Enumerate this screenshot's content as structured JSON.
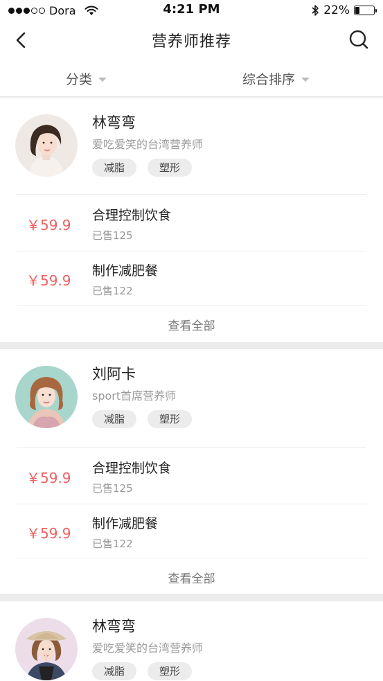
{
  "status_bar": {
    "carrier": "Dora",
    "time": "4:21 PM",
    "battery": "22%",
    "battery_level": 0.22
  },
  "nav": {
    "title": "营养师推荐"
  },
  "filters": {
    "category": "分类",
    "sort": "综合排序"
  },
  "nutritionists": [
    {
      "name": "林弯弯",
      "desc": "爱吃爱笑的台湾营养师",
      "tags": [
        "减脂",
        "塑形"
      ],
      "products": [
        {
          "price": "￥59.9",
          "name": "合理控制饮食",
          "sold": "已售125"
        },
        {
          "price": "￥59.9",
          "name": "制作减肥餐",
          "sold": "已售122"
        }
      ],
      "view_all": "查看全部"
    },
    {
      "name": "刘阿卡",
      "desc": "sport首席营养师",
      "tags": [
        "减脂",
        "塑形"
      ],
      "products": [
        {
          "price": "￥59.9",
          "name": "合理控制饮食",
          "sold": "已售125"
        },
        {
          "price": "￥59.9",
          "name": "制作减肥餐",
          "sold": "已售122"
        }
      ],
      "view_all": "查看全部"
    },
    {
      "name": "林弯弯",
      "desc": "爱吃爱笑的台湾营养师",
      "tags": [
        "减脂",
        "塑形"
      ]
    }
  ],
  "colors": {
    "price": "#f06060",
    "background": "#ebebeb",
    "tag_bg": "#ececec"
  },
  "icons": {
    "back": "chevron-left-icon",
    "search": "search-icon",
    "wifi": "wifi-icon",
    "bluetooth": "bluetooth-icon",
    "battery": "battery-icon",
    "caret": "caret-down-icon"
  }
}
